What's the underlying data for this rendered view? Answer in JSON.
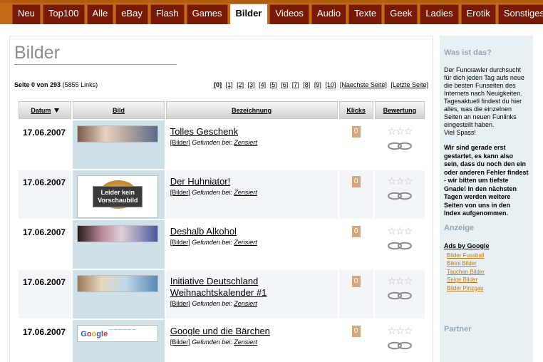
{
  "nav": {
    "tabs": [
      "Neu",
      "Top100",
      "Alle",
      "eBay",
      "Flash",
      "Games",
      "Bilder",
      "Videos",
      "Audio",
      "Texte",
      "Geek",
      "Ladies",
      "Erotik",
      "Sonstiges"
    ],
    "active": "Bilder"
  },
  "main": {
    "title": "Bilder",
    "page_prefix": "Seite 0 von 293",
    "page_count": "(5855 Links)",
    "pager": {
      "pages": [
        "[0]",
        "[1]",
        "[2]",
        "[3]",
        "[4]",
        "[5]",
        "[6]",
        "[7]",
        "[8]",
        "[9]",
        "[10]"
      ],
      "next": "[Naechste Seite]",
      "last": "[Letzte Seite]"
    },
    "columns": {
      "date": "Datum",
      "image": "Bild",
      "name": "Bezeichnung",
      "clicks": "Klicks",
      "rating": "Bewertung"
    },
    "entry_labels": {
      "category": "[Bilder]",
      "found_at": "Gefunden bei:"
    },
    "rows": [
      {
        "date": "17.06.2007",
        "title": "Tolles Geschenk",
        "source": "Zensiert",
        "clicks": "0"
      },
      {
        "date": "17.06.2007",
        "title": "Der Huhniator!",
        "source": "Zensiert",
        "clicks": "0",
        "image_text_1": "Leider kein",
        "image_text_2": "Vorschaubild"
      },
      {
        "date": "17.06.2007",
        "title": "Deshalb Alkohol",
        "source": "Zensiert",
        "clicks": "0"
      },
      {
        "date": "17.06.2007",
        "title": "Initiative Deutschland Weihnachtskalender #1",
        "source": "Zensiert",
        "clicks": "0"
      },
      {
        "date": "17.06.2007",
        "title": "Google und die Bärchen",
        "source": "Zensiert",
        "clicks": "0"
      }
    ]
  },
  "sidebar": {
    "about_heading": "Was ist das?",
    "about_text": "Der Funcrawler durchsucht für dich jeden Tag aufs neue die besten Funseiten des Internets nach Neuigkeiten. Tagesaktuell findest du hier alles, was die einzelnen Seiten an neuen Funlinks eingestellt haben.",
    "about_text_2": "Viel Spass!",
    "notice": "Wir sind gerade erst gestartet, es kann also sein, dass du noch den ein oder anderen Fehler findest - wir bitten um tiefste Gnade! In den nächsten Tagen werden weitere Seiten von uns in den Index aufgenommen.",
    "ad_heading": "Anzeige",
    "ads_title": "Ads by Google",
    "ads": [
      "Bilder Fussball",
      "Bikini Bilder",
      "Tauchen Bilder",
      "Seige Bilder",
      "Bilder Pinzgau"
    ],
    "partner_heading": "Partner"
  },
  "icons": {
    "sort": "triangle-down",
    "rating": "star-outline",
    "vote": "chain-link"
  },
  "colors": {
    "nav_bg": "#c26a14",
    "tab_bg": "#7a1906",
    "image_col_bg": "#cfe0e9",
    "sidebar_bg": "#e9f0f3",
    "clicks_badge": "#d7a77f",
    "ad_link": "#c07a1a"
  }
}
